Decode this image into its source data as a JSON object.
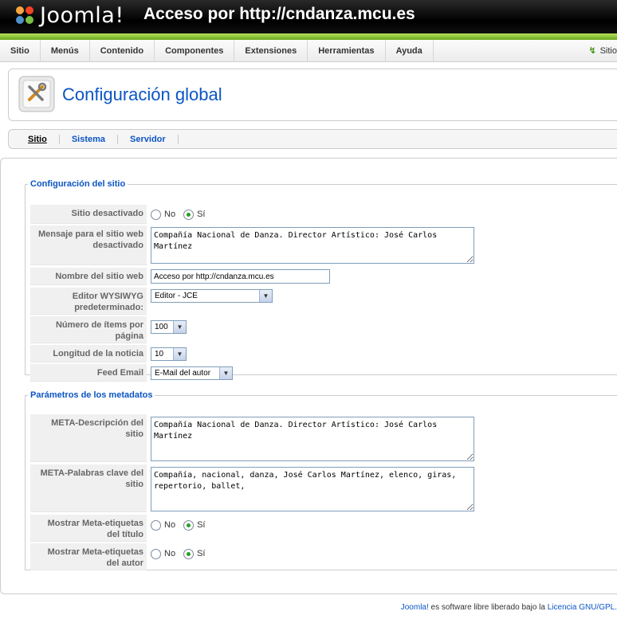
{
  "header": {
    "logo_text": "Joomla!",
    "site_title": "Acceso por http://cndanza.mcu.es"
  },
  "menu": {
    "items": [
      "Sitio",
      "Menús",
      "Contenido",
      "Componentes",
      "Extensiones",
      "Herramientas",
      "Ayuda"
    ],
    "right_text": "Sitio"
  },
  "toolbar": {
    "title": "Configuración global",
    "icon": "tools-icon"
  },
  "tabs": [
    "Sitio",
    "Sistema",
    "Servidor"
  ],
  "site_config": {
    "legend": "Configuración del sitio",
    "offline_label": "Sitio desactivado",
    "offline_no": "No",
    "offline_yes": "Sí",
    "offline_message_label": "Mensaje para el sitio web desactivado",
    "offline_message_value": "Compañía Nacional de Danza. Director Artístico: José Carlos Martínez",
    "site_name_label": "Nombre del sitio web",
    "site_name_value": "Acceso por http://cndanza.mcu.es",
    "editor_label": "Editor WYSIWYG predeterminado:",
    "editor_value": "Editor - JCE",
    "list_limit_label": "Número de ítems por página",
    "list_limit_value": "100",
    "feed_limit_label": "Longitud de la noticia",
    "feed_limit_value": "10",
    "feed_email_label": "Feed Email",
    "feed_email_value": "E-Mail del autor"
  },
  "metadata": {
    "legend": "Parámetros de los metadatos",
    "desc_label": "META-Descripción del sitio",
    "desc_value": "Compañía Nacional de Danza. Director Artístico: José Carlos Martínez",
    "keywords_label": "META-Palabras clave del sitio",
    "keywords_value": "Compañía, nacional, danza, José Carlos Martínez, elenco, giras, repertorio, ballet,",
    "show_title_label": "Mostrar Meta-etiquetas del título",
    "show_author_label": "Mostrar Meta-etiquetas del autor",
    "no": "No",
    "yes": "Sí"
  },
  "footer": {
    "link1": "Joomla!",
    "text": " es software libre liberado bajo la ",
    "link2": "Licencia GNU/GPL."
  }
}
